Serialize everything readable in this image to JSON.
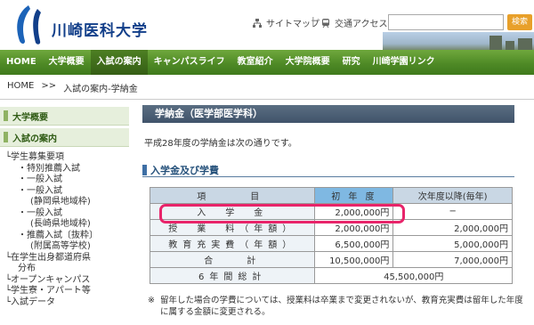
{
  "header": {
    "logo_text": "川崎医科大学",
    "util_links": [
      "サイトマップ",
      "交通アクセス"
    ],
    "search_placeholder": "",
    "search_button": "検索"
  },
  "nav": {
    "items": [
      {
        "label": "HOME",
        "active": false
      },
      {
        "label": "大学概要",
        "active": false
      },
      {
        "label": "入試の案内",
        "active": true
      },
      {
        "label": "キャンパスライフ",
        "active": false
      },
      {
        "label": "教室紹介",
        "active": false
      },
      {
        "label": "大学院概要",
        "active": false
      },
      {
        "label": "研究",
        "active": false
      },
      {
        "label": "川崎学園リンク",
        "active": false
      }
    ]
  },
  "breadcrumb": {
    "home": "HOME",
    "sep": ">>",
    "current": "入試の案内-学納金"
  },
  "sidebar": {
    "heads": [
      "大学概要",
      "入試の案内"
    ],
    "items": [
      {
        "level": 1,
        "label": "└学生募集要項"
      },
      {
        "level": 2,
        "label": "・特別推薦入試"
      },
      {
        "level": 2,
        "label": "・一般入試"
      },
      {
        "level": 2,
        "label": "・一般入試"
      },
      {
        "level": 3,
        "label": "(静岡県地域枠)"
      },
      {
        "level": 2,
        "label": "・一般入試"
      },
      {
        "level": 3,
        "label": "(長崎県地域枠)"
      },
      {
        "level": 2,
        "label": "・推薦入試〔抜粋〕"
      },
      {
        "level": 3,
        "label": "(附属高等学校)"
      },
      {
        "level": 1,
        "label": "└在学生出身都道府県"
      },
      {
        "level": 2,
        "label": "分布"
      },
      {
        "level": 1,
        "label": "└オープンキャンパス"
      },
      {
        "level": 1,
        "label": "└学生寮・アパート等"
      },
      {
        "level": 1,
        "label": "└入試データ"
      }
    ]
  },
  "main": {
    "title": "学納金（医学部医学科）",
    "intro": "平成28年度の学納金は次の通りです。",
    "section": "入学金及び学費",
    "table": {
      "headers": {
        "item": "項　　目",
        "first": "初 年 度",
        "later": "次年度以降(毎年)"
      },
      "rows": [
        {
          "item": "入　学　金",
          "first": "2,000,000円",
          "later": "−"
        },
        {
          "item": "授　業　料（年額）",
          "first": "2,000,000円",
          "later": "2,000,000円"
        },
        {
          "item": "教育充実費（年額）",
          "first": "6,500,000円",
          "later": "5,000,000円"
        },
        {
          "item": "合　　計",
          "first": "10,500,000円",
          "later": "7,000,000円"
        }
      ],
      "total_row": {
        "item": "6年間総計",
        "value": "45,500,000円"
      }
    },
    "note_mark": "※",
    "note": "留年した場合の学費については、授業料は卒業まで変更されないが、教育充実費は留年した年度に属する金額に変更される。"
  },
  "colors": {
    "nav_green": "#4f8a26",
    "title_bar": "#40536a",
    "highlight": "#e8246a",
    "header_blue": "#7fb8e2"
  }
}
